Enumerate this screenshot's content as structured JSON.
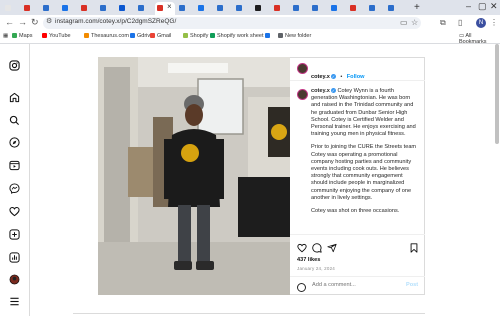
{
  "browser": {
    "url": "instagram.com/cotey.x/p/C2dgmSZReQG/",
    "tab_colors": [
      "#e6e6e6",
      "#d93025",
      "#2c6ecb",
      "#1a73e8",
      "#d93025",
      "#2c6ecb",
      "#0b57d0",
      "#2c6ecb",
      "#d93025",
      "#2c6ecb",
      "#1a73e8",
      "#2c6ecb",
      "#2c6ecb",
      "#1d1d1f",
      "#d93025",
      "#2c6ecb",
      "#2c6ecb",
      "#1a73e8",
      "#d93025",
      "#2c6ecb",
      "#2c6ecb"
    ],
    "active_tab_close": "×",
    "new_tab": "+",
    "bookmarks": [
      {
        "label": "Maps",
        "color": "#34a853"
      },
      {
        "label": "YouTube",
        "color": "#ff0000"
      },
      {
        "label": "Thesaurus.com",
        "color": "#f28b00"
      },
      {
        "label": "Gdrive",
        "color": "#1a73e8"
      },
      {
        "label": "Gmail",
        "color": "#ea4335"
      },
      {
        "label": "Shopify",
        "color": "#95bf47"
      },
      {
        "label": "Shopify work sheet",
        "color": "#0f9d58"
      },
      {
        "label": "",
        "color": "#1a73e8"
      },
      {
        "label": "New folder",
        "color": "#5f6368"
      }
    ],
    "all_bookmarks": "All Bookmarks",
    "profile_initial": "N"
  },
  "post": {
    "username": "cotey.x",
    "follow_label": "Follow",
    "caption_paragraphs": [
      "Cotey Wynn is a fourth generation Washingtonian. He was born and raised in the Trinidad community and he graduated from Dunbar Senior High School. Cotey is Certified Welder and Personal trainer. He enjoys exercising and training young men in physical fitness.",
      "Prior to joining the CURE the Streets team Cotey was operating a promotional company hosting parties and community events including cook outs. He believes strongly that community engagement should include people in marginalized community enjoying the company of one another in lively settings.",
      "Cotey was shot on three occasions."
    ],
    "likes": "437 likes",
    "date": "January 24, 2024",
    "comment_placeholder": "Add a comment...",
    "post_label": "Post"
  }
}
